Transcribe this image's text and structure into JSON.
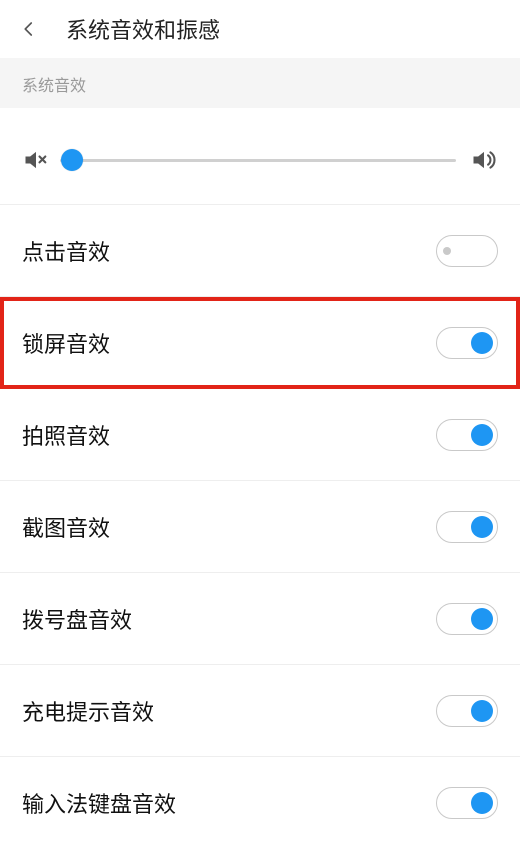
{
  "header": {
    "title": "系统音效和振感"
  },
  "section": {
    "title": "系统音效"
  },
  "volume": {
    "percent": 3
  },
  "items": [
    {
      "label": "点击音效",
      "on": false,
      "highlighted": false
    },
    {
      "label": "锁屏音效",
      "on": true,
      "highlighted": true
    },
    {
      "label": "拍照音效",
      "on": true,
      "highlighted": false
    },
    {
      "label": "截图音效",
      "on": true,
      "highlighted": false
    },
    {
      "label": "拨号盘音效",
      "on": true,
      "highlighted": false
    },
    {
      "label": "充电提示音效",
      "on": true,
      "highlighted": false
    },
    {
      "label": "输入法键盘音效",
      "on": true,
      "highlighted": false
    }
  ],
  "colors": {
    "accent": "#1e96f3",
    "highlight_border": "#e22418"
  }
}
